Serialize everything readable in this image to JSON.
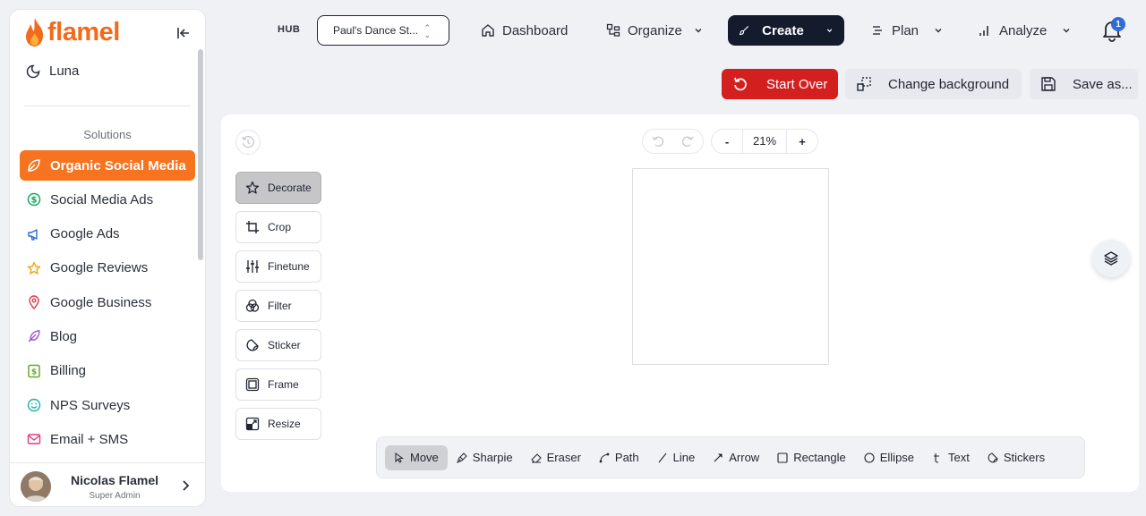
{
  "sidebar": {
    "brand": "flamel",
    "luna": "Luna",
    "section_title": "Solutions",
    "items": [
      {
        "label": "Organic Social Media",
        "icon": "leaf-icon",
        "color": "#ffffff"
      },
      {
        "label": "Social Media Ads",
        "icon": "dollar-circle-icon",
        "color": "#1aa661"
      },
      {
        "label": "Google Ads",
        "icon": "megaphone-icon",
        "color": "#2f6bd9"
      },
      {
        "label": "Google Reviews",
        "icon": "star-icon",
        "color": "#f0a41c"
      },
      {
        "label": "Google Business",
        "icon": "map-pin-icon",
        "color": "#e0394a"
      },
      {
        "label": "Blog",
        "icon": "feather-icon",
        "color": "#9b59d0"
      },
      {
        "label": "Billing",
        "icon": "dollar-square-icon",
        "color": "#6aa62b"
      },
      {
        "label": "NPS Surveys",
        "icon": "smile-icon",
        "color": "#1bb3a6"
      },
      {
        "label": "Email + SMS",
        "icon": "mail-icon",
        "color": "#e0397a"
      }
    ],
    "user": {
      "name": "Nicolas Flamel",
      "role": "Super Admin"
    }
  },
  "header": {
    "hub_label": "HUB",
    "hub_value": "Paul's Dance St...",
    "nav": {
      "dashboard": "Dashboard",
      "organize": "Organize",
      "create": "Create",
      "plan": "Plan",
      "analyze": "Analyze"
    },
    "notification_count": "1"
  },
  "actions": {
    "start_over": "Start Over",
    "change_background": "Change background",
    "save_as": "Save as..."
  },
  "editor": {
    "zoom": "21%",
    "zoom_out": "-",
    "zoom_in": "+",
    "tools": [
      "Decorate",
      "Crop",
      "Finetune",
      "Filter",
      "Sticker",
      "Frame",
      "Resize"
    ],
    "draw_tools": [
      "Move",
      "Sharpie",
      "Eraser",
      "Path",
      "Line",
      "Arrow",
      "Rectangle",
      "Ellipse",
      "Text",
      "Stickers"
    ]
  },
  "colors": {
    "brand_orange": "#f6731f",
    "create_dark": "#141b2d",
    "start_over_red": "#d3201f"
  }
}
